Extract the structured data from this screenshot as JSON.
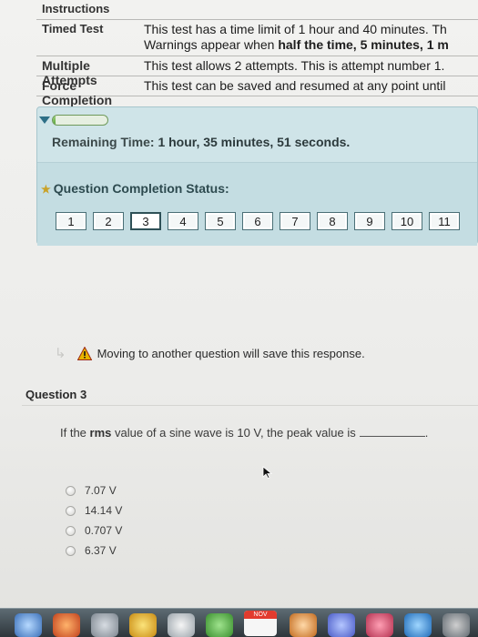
{
  "instructions": {
    "label": "Instructions",
    "rows": [
      {
        "label": "Timed Test",
        "line1": "This test has a time limit of 1 hour and 40 minutes. Th",
        "line2_pre": "Warnings appear when ",
        "line2_bold": "half the time, 5 minutes, 1 m"
      },
      {
        "label": "Multiple Attempts",
        "text": "This test allows 2 attempts. This is attempt number 1."
      },
      {
        "label": "Force Completion",
        "text": "This test can be saved and resumed at any point until"
      }
    ]
  },
  "timer": {
    "progress_fraction": 0.05,
    "remaining_label": "Remaining Time:",
    "remaining_value": "1 hour, 35 minutes, 51 seconds."
  },
  "status": {
    "title": "Question Completion Status:",
    "questions": [
      "1",
      "2",
      "3",
      "4",
      "5",
      "6",
      "7",
      "8",
      "9",
      "10",
      "11"
    ],
    "current": "3"
  },
  "notice": {
    "text": "Moving to another question will save this response."
  },
  "question": {
    "header": "Question 3",
    "text_pre": "If the ",
    "text_bold": "rms",
    "text_post": " value of a sine wave is 10 V, the peak value is",
    "text_end": "."
  },
  "options": [
    "7.07 V",
    "14.14 V",
    "0.707 V",
    "6.37 V"
  ],
  "dock": {
    "calendar_month": "NOV"
  },
  "colors": {
    "panel_bg": "#cfe4e8",
    "progress_fill": "#58a43a",
    "warning": "#d9a400"
  }
}
